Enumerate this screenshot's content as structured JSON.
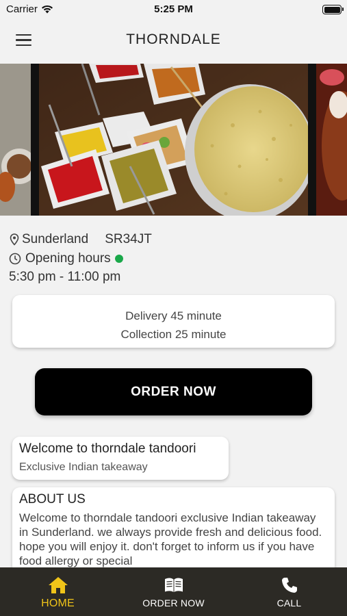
{
  "status_bar": {
    "carrier": "Carrier",
    "time": "5:25 PM"
  },
  "header": {
    "title": "THORNDALE",
    "menu_icon": "hamburger-menu-icon"
  },
  "banner": {
    "description_icon": "food-photo-carousel"
  },
  "info": {
    "location": "Sunderland",
    "postcode": "SR34JT",
    "opening_label": "Opening hours",
    "open_status_color": "#1aa84a",
    "hours": "5:30 pm - 11:00 pm"
  },
  "delivery": {
    "delivery_time": "Delivery 45 minute",
    "collection_time": "Collection 25 minute"
  },
  "order_button": {
    "label": "ORDER NOW"
  },
  "welcome": {
    "title": "Welcome to thorndale tandoori",
    "subtitle": "Exclusive Indian takeaway"
  },
  "about": {
    "title": "ABOUT US",
    "body": "Welcome to thorndale tandoori exclusive Indian takeaway in Sunderland. we always provide fresh and delicious food. hope you will enjoy it. don't forget to inform us if you have food allergy or special"
  },
  "tab_bar": {
    "tabs": [
      {
        "label": "HOME",
        "icon": "home-icon",
        "active": true
      },
      {
        "label": "ORDER NOW",
        "icon": "menu-book-icon",
        "active": false
      },
      {
        "label": "CALL",
        "icon": "phone-icon",
        "active": false
      }
    ],
    "active_color": "#f0c419",
    "background": "#2c2a25"
  }
}
